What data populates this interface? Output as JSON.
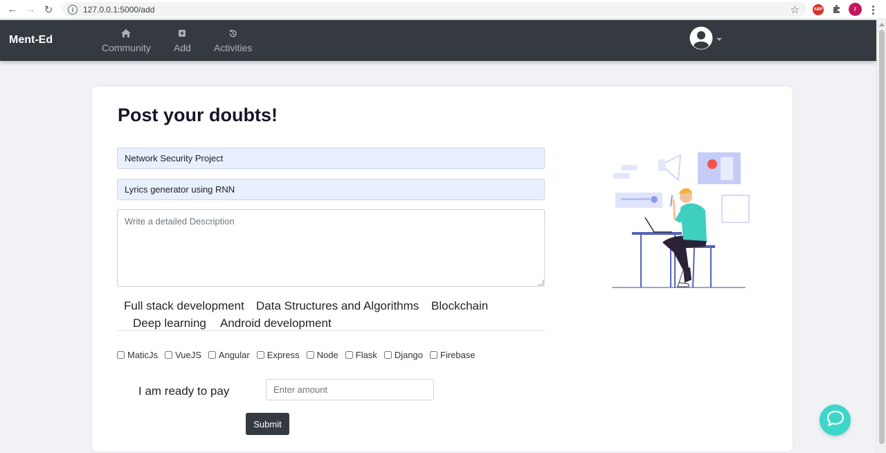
{
  "browser": {
    "url": "127.0.0.1:5000/add",
    "profile_initial": "r",
    "ext_label": "ABP"
  },
  "navbar": {
    "brand": "Ment-Ed",
    "items": [
      {
        "label": "Community",
        "icon": "home-icon"
      },
      {
        "label": "Add",
        "icon": "plus-square-icon"
      },
      {
        "label": "Activities",
        "icon": "history-icon"
      }
    ],
    "avatar_icon": "user-circle-icon"
  },
  "form": {
    "title": "Post your doubts!",
    "field1_value": "Network Security Project",
    "field2_value": "Lyrics generator using RNN",
    "description_placeholder": "Write a detailed Description",
    "topics": [
      "Full stack development",
      "Data Structures and Algorithms",
      "Blockchain",
      "Deep learning",
      "Android development"
    ],
    "technologies": [
      "MaticJs",
      "VueJS",
      "Angular",
      "Express",
      "Node",
      "Flask",
      "Django",
      "Firebase"
    ],
    "pay_label": "I am ready to pay",
    "amount_placeholder": "Enter amount",
    "submit_label": "Submit"
  },
  "colors": {
    "navbar_bg": "#343a40",
    "accent_chat": "#3ed6c8",
    "illustration_shirt": "#3ecfbf",
    "illustration_accent": "#ef5350"
  }
}
